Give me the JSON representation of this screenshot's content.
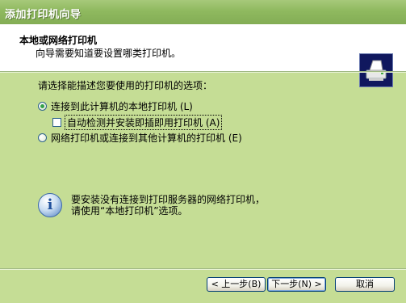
{
  "window": {
    "title": "添加打印机向导"
  },
  "header": {
    "title": "本地或网络打印机",
    "subtitle": "向导需要知道要设置哪类打印机。",
    "icon": "printer-icon"
  },
  "body": {
    "prompt": "请选择能描述您要使用的打印机的选项：",
    "options": [
      {
        "label": "连接到此计算机的本地打印机 (L)",
        "selected": true
      },
      {
        "label": "自动检测并安装即插即用打印机 (A)",
        "checked": false
      },
      {
        "label": "网络打印机或连接到其他计算机的打印机 (E)",
        "selected": false
      }
    ],
    "info": {
      "icon": "info-icon",
      "line1": "要安装没有连接到打印服务器的网络打印机，",
      "line2": "请使用“本地打印机”选项。"
    }
  },
  "buttons": {
    "back": "< 上一步(B)",
    "next": "下一步(N) >",
    "cancel": "取消"
  },
  "colors": {
    "titlebar": "#8fb95f",
    "dialog": "#c5dd95",
    "header": "#ffffff"
  }
}
